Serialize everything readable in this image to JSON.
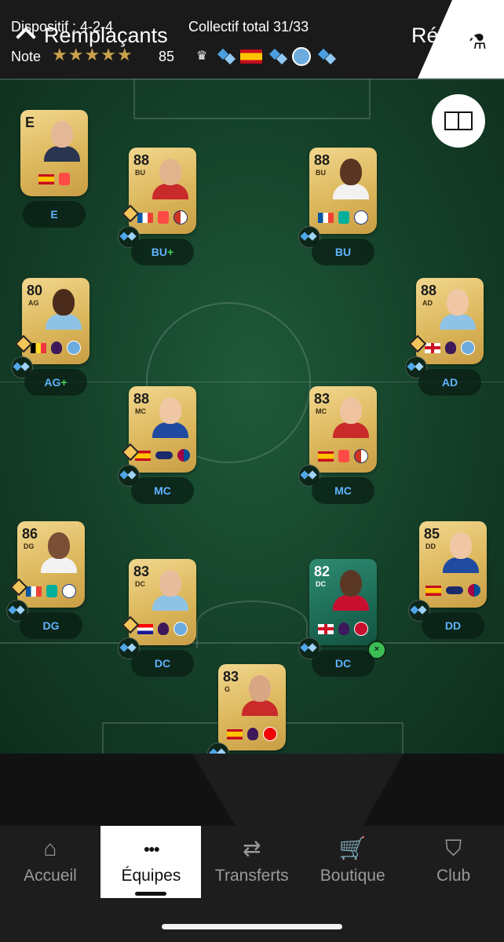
{
  "header": {
    "formation": "Dispositif : 4-2-4",
    "chemistry": "Collectif total 31/33",
    "rating_label": "Note",
    "stars": "★★★★★",
    "rating_value": "85",
    "lab_icon": "flask-icon"
  },
  "players": [
    {
      "id": "manager",
      "rating": "E",
      "position": "",
      "label": "E",
      "plus": "",
      "flags": [
        "es"
      ],
      "leagues": [
        "laliga"
      ],
      "clubs": [],
      "skin": "#e4b896",
      "shirt": "#2a3550",
      "trait": false,
      "chem": false,
      "green": false
    },
    {
      "id": "bu-left",
      "rating": "88",
      "position": "BU",
      "label": "BU",
      "plus": "+",
      "flags": [
        "fr"
      ],
      "leagues": [
        "laliga"
      ],
      "clubs": [
        "atm"
      ],
      "skin": "#e2b48e",
      "shirt": "#c92a2a",
      "trait": true,
      "chem": true,
      "green": false
    },
    {
      "id": "bu-right",
      "rating": "88",
      "position": "BU",
      "label": "BU",
      "plus": "",
      "flags": [
        "fr"
      ],
      "leagues": [
        "d1"
      ],
      "clubs": [
        "lyon"
      ],
      "skin": "#5a3521",
      "shirt": "#f2f2f2",
      "trait": false,
      "chem": true,
      "green": false
    },
    {
      "id": "ag",
      "rating": "80",
      "position": "AG",
      "label": "AG",
      "plus": "+",
      "flags": [
        "be"
      ],
      "leagues": [
        "pl"
      ],
      "clubs": [
        "mci"
      ],
      "skin": "#4a2b1c",
      "shirt": "#8fc3e6",
      "trait": true,
      "chem": true,
      "green": false
    },
    {
      "id": "ad",
      "rating": "88",
      "position": "AD",
      "label": "AD",
      "plus": "",
      "flags": [
        "en"
      ],
      "leagues": [
        "pl"
      ],
      "clubs": [
        "mci"
      ],
      "skin": "#f0c7a5",
      "shirt": "#8fc3e6",
      "trait": true,
      "chem": true,
      "green": false
    },
    {
      "id": "mc-left",
      "rating": "88",
      "position": "MC",
      "label": "MC",
      "plus": "",
      "flags": [
        "es"
      ],
      "leagues": [
        "ligaf"
      ],
      "clubs": [
        "fcb"
      ],
      "skin": "#f0c7a5",
      "shirt": "#1f4aa0",
      "trait": true,
      "chem": true,
      "green": false
    },
    {
      "id": "mc-right",
      "rating": "83",
      "position": "MC",
      "label": "MC",
      "plus": "",
      "flags": [
        "es"
      ],
      "leagues": [
        "laliga"
      ],
      "clubs": [
        "atm"
      ],
      "skin": "#efc3a0",
      "shirt": "#c92a2a",
      "trait": false,
      "chem": true,
      "green": false
    },
    {
      "id": "dg",
      "rating": "86",
      "position": "DG",
      "label": "DG",
      "plus": "",
      "flags": [
        "fr"
      ],
      "leagues": [
        "d1"
      ],
      "clubs": [
        "lyon"
      ],
      "skin": "#7a4f35",
      "shirt": "#f2f2f2",
      "trait": true,
      "chem": true,
      "green": false
    },
    {
      "id": "dc-left",
      "rating": "83",
      "position": "DC",
      "label": "DC",
      "plus": "",
      "flags": [
        "hr"
      ],
      "leagues": [
        "pl"
      ],
      "clubs": [
        "mci"
      ],
      "skin": "#e8bd9c",
      "shirt": "#8fc3e6",
      "trait": true,
      "chem": true,
      "green": false
    },
    {
      "id": "dc-right",
      "rating": "82",
      "position": "DC",
      "label": "DC",
      "plus": "",
      "flags": [
        "en"
      ],
      "leagues": [
        "pl"
      ],
      "clubs": [
        "liv"
      ],
      "skin": "#5a3825",
      "shirt": "#c8102e",
      "trait": false,
      "chem": true,
      "green": true
    },
    {
      "id": "dd",
      "rating": "85",
      "position": "DD",
      "label": "DD",
      "plus": "",
      "flags": [
        "es"
      ],
      "leagues": [
        "ligaf"
      ],
      "clubs": [
        "fcb"
      ],
      "skin": "#f0c7a5",
      "shirt": "#1f4aa0",
      "trait": false,
      "chem": true,
      "green": false
    },
    {
      "id": "g",
      "rating": "83",
      "position": "G",
      "label": "G",
      "plus": "",
      "flags": [
        "es"
      ],
      "leagues": [
        "pl"
      ],
      "clubs": [
        "ars"
      ],
      "skin": "#d9a684",
      "shirt": "#c92a2a",
      "trait": false,
      "chem": true,
      "green": false
    }
  ],
  "subs_tab": "Remplaçants",
  "reserves_tab": "Rés",
  "nav": [
    {
      "id": "home",
      "icon": "home-icon",
      "glyph": "⌂",
      "label": "Accueil",
      "active": false
    },
    {
      "id": "teams",
      "icon": "team-icon",
      "glyph": "●●●",
      "label": "Équipes",
      "active": true
    },
    {
      "id": "transfers",
      "icon": "transfer-arrows-icon",
      "glyph": "⇄",
      "label": "Transferts",
      "active": false
    },
    {
      "id": "store",
      "icon": "cart-icon",
      "glyph": "🛒",
      "label": "Boutique",
      "active": false
    },
    {
      "id": "club",
      "icon": "club-shield-icon",
      "glyph": "⛉",
      "label": "Club",
      "active": false
    }
  ],
  "colors": {
    "pitch": "#1a4d32",
    "label_text": "#5fb3ff",
    "plus": "#46d35a",
    "gold": "#c9a24a"
  }
}
